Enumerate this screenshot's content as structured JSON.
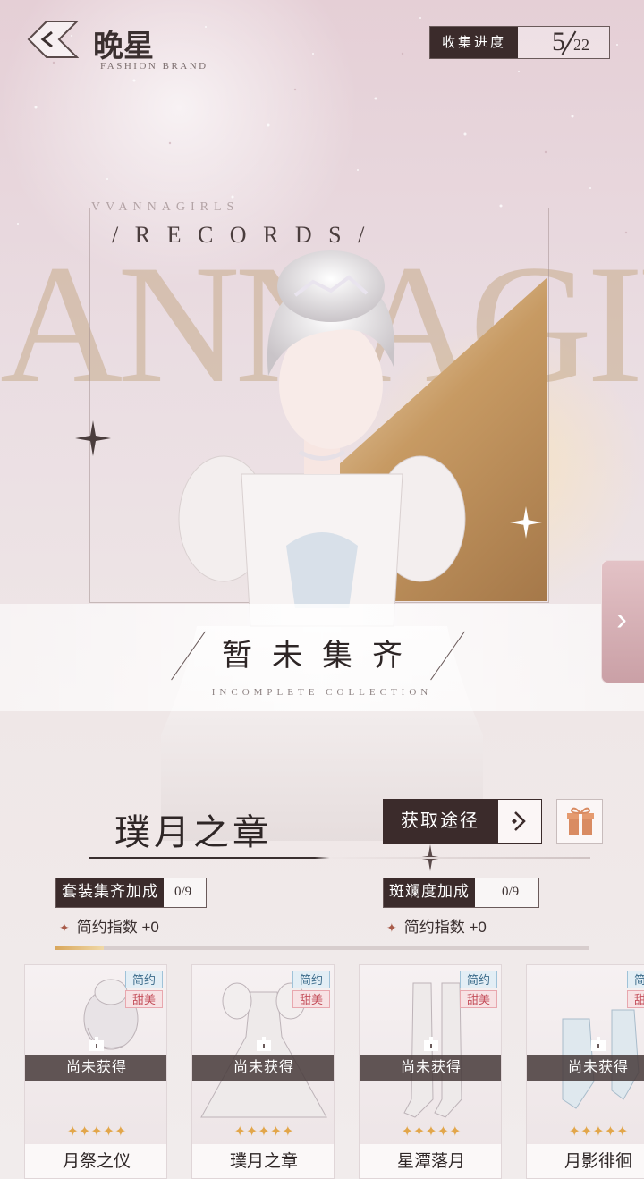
{
  "header": {
    "brand_title": "晚星",
    "brand_subtitle": "FASHION BRAND",
    "progress_label": "收集进度",
    "progress_current": "5",
    "progress_total": "22"
  },
  "hero": {
    "records_small": "VVANNAGIRLS",
    "records": "/ R E C O R D S /",
    "big_letters": "ANNAGIR",
    "status": "暂未集齐",
    "status_sub": "INCOMPLETE    COLLECTION"
  },
  "suit": {
    "title": "璞月之章",
    "source_button": "获取途径"
  },
  "bonuses": [
    {
      "label": "套装集齐加成",
      "value": "0/9",
      "stat": "简约指数",
      "stat_value": "+0"
    },
    {
      "label": "斑斓度加成",
      "value": "0/9",
      "stat": "简约指数",
      "stat_value": "+0"
    }
  ],
  "collection_progress": 0.09,
  "cards": [
    {
      "name": "月祭之仪",
      "status": "尚未获得",
      "tags": [
        "简约",
        "甜美"
      ],
      "stars": 5,
      "icon": "hairpiece"
    },
    {
      "name": "璞月之章",
      "status": "尚未获得",
      "tags": [
        "简约",
        "甜美"
      ],
      "stars": 5,
      "icon": "gown"
    },
    {
      "name": "星潭落月",
      "status": "尚未获得",
      "tags": [
        "简约",
        "甜美"
      ],
      "stars": 5,
      "icon": "stockings"
    },
    {
      "name": "月影徘徊",
      "status": "尚未获得",
      "tags": [
        "简约",
        "甜美"
      ],
      "stars": 5,
      "icon": "heels"
    }
  ],
  "colors": {
    "dark": "#3b2b2b",
    "gold": "#c79a63",
    "tag_simple": "#3e6d8c",
    "tag_sweet": "#c4505c",
    "star": "#e2a64a"
  }
}
